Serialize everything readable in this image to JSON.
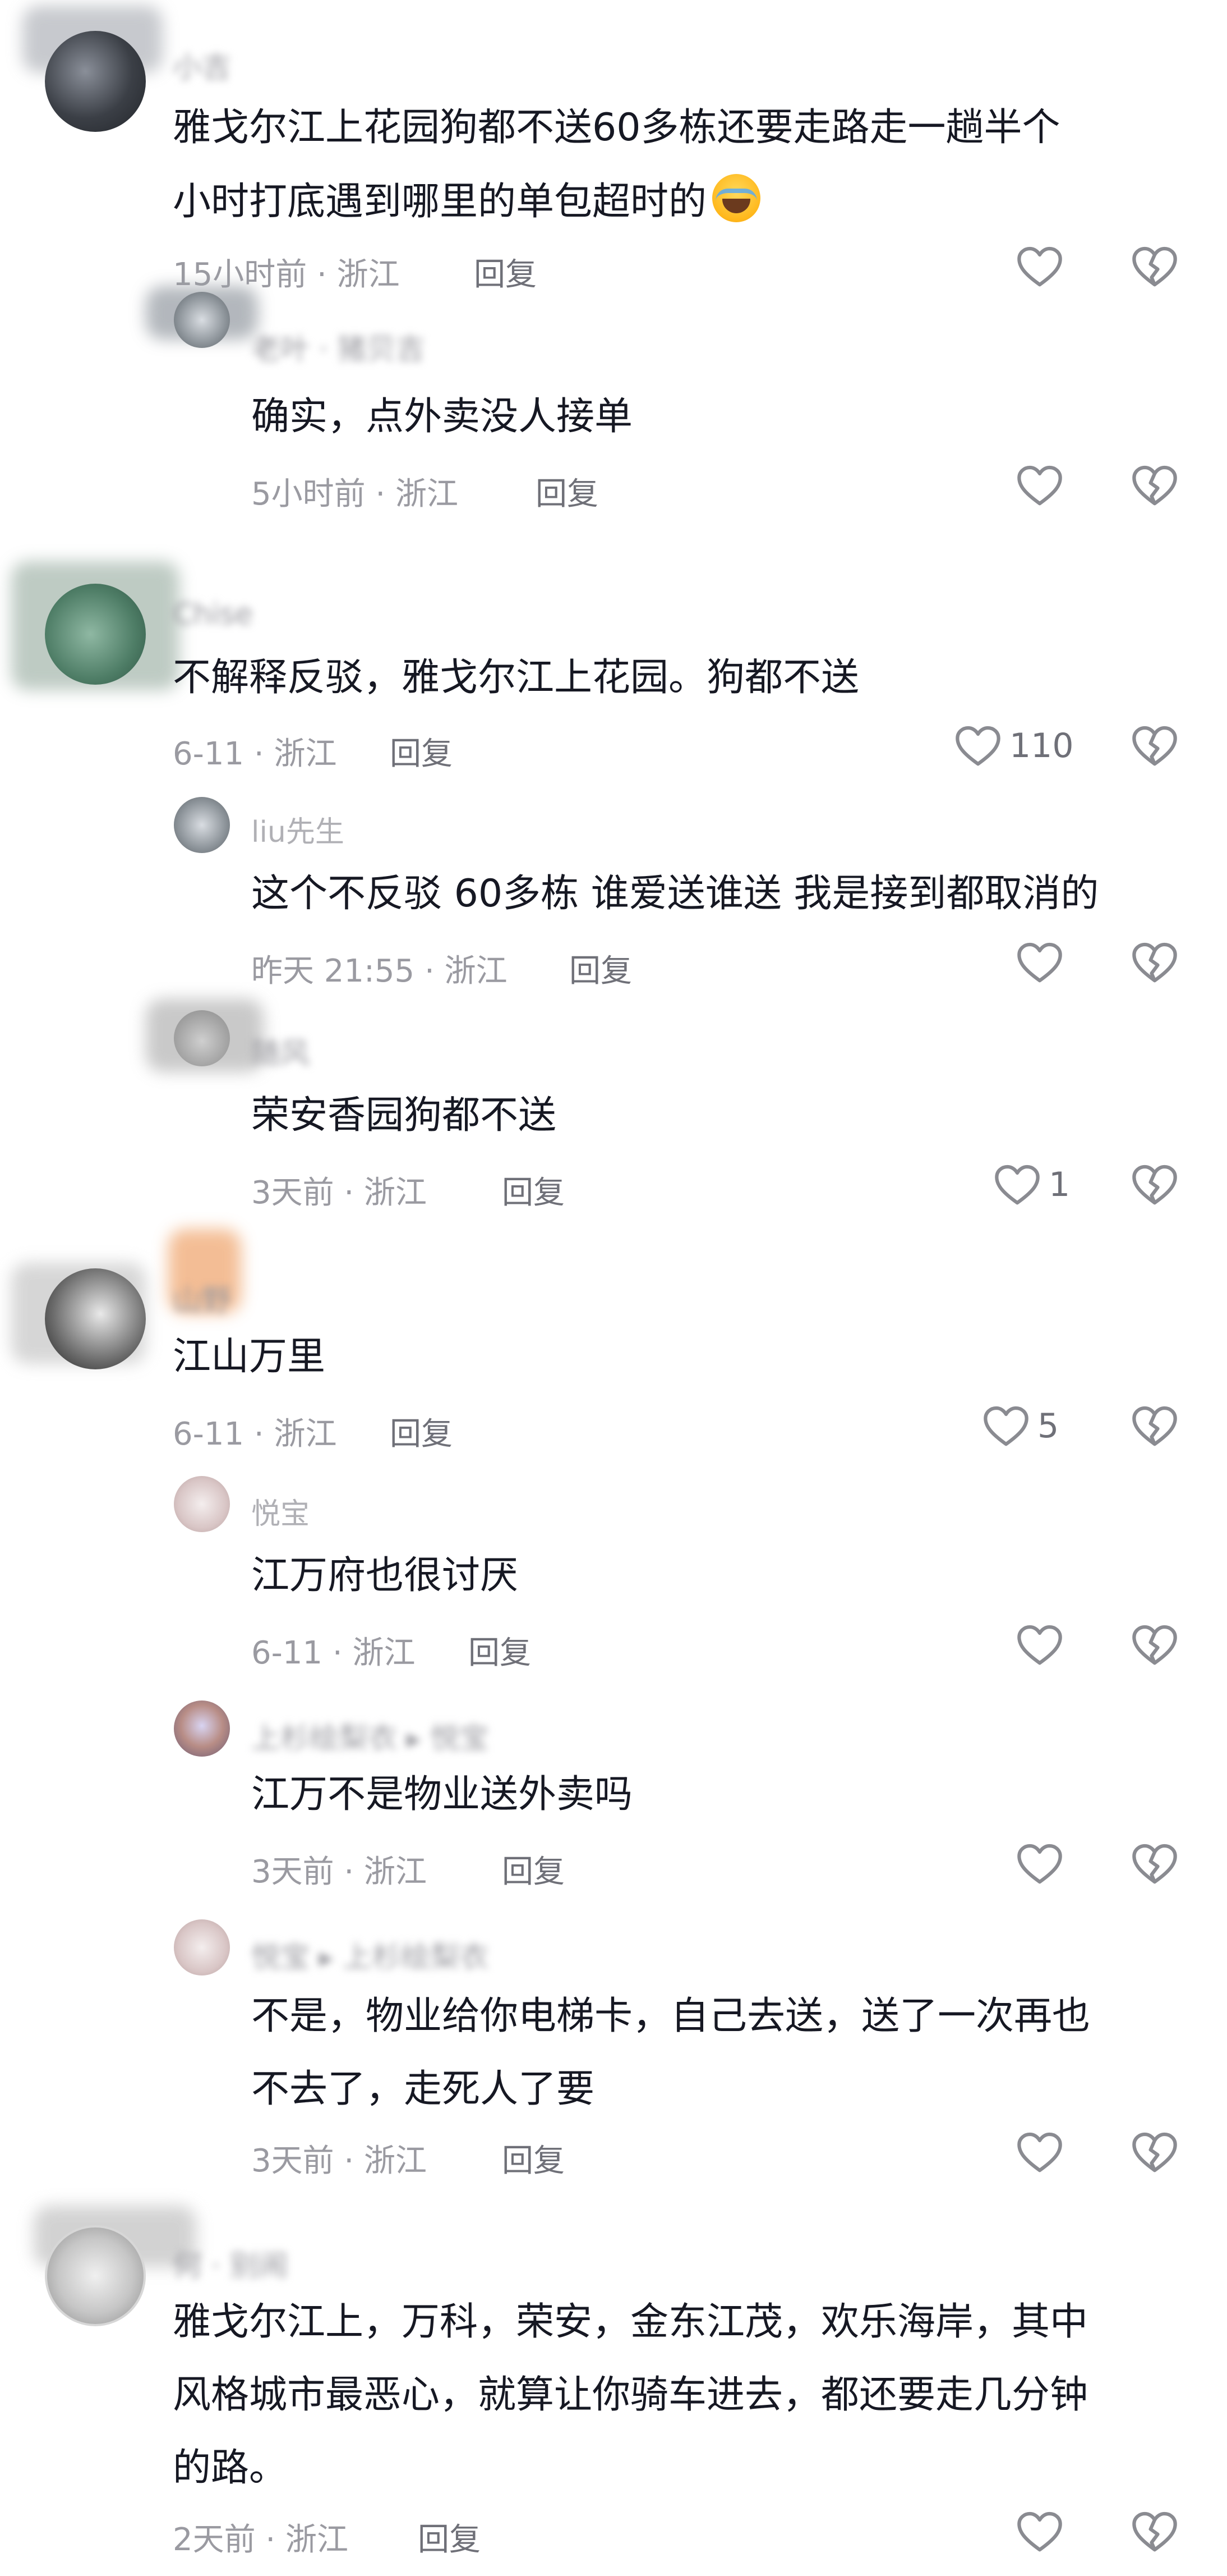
{
  "reply_label": "回复",
  "comments": [
    {
      "name": "小吉",
      "text_lines": [
        "雅戈尔江上花园狗都不送60多栋还要走路走一趟半个",
        "小时打底遇到哪里的单包超时的"
      ],
      "meta": "15小时前 · 浙江",
      "likes": ""
    },
    {
      "name": "老叶 · 猪贝吉",
      "text_lines": [
        "确实，点外卖没人接单"
      ],
      "meta": "5小时前 · 浙江",
      "likes": ""
    },
    {
      "name": "Chise",
      "text_lines": [
        "不解释反驳，雅戈尔江上花园。狗都不送"
      ],
      "meta": "6-11 · 浙江",
      "likes": "110"
    },
    {
      "name": "liu先生",
      "text_lines": [
        "这个不反驳 60多栋 谁爱送谁送 我是接到都取消的"
      ],
      "meta": "昨天 21:55 · 浙江",
      "likes": ""
    },
    {
      "name": "随风",
      "text_lines": [
        "荣安香园狗都不送"
      ],
      "meta": "3天前 · 浙江",
      "likes": "1"
    },
    {
      "name": "山野",
      "text_lines": [
        "江山万里"
      ],
      "meta": "6-11 · 浙江",
      "likes": "5"
    },
    {
      "name": "悦宝",
      "text_lines": [
        "江万府也很讨厌"
      ],
      "meta": "6-11 · 浙江",
      "likes": ""
    },
    {
      "name": "上杉绘梨衣 ▸ 悦宝",
      "text_lines": [
        "江万不是物业送外卖吗"
      ],
      "meta": "3天前 · 浙江",
      "likes": ""
    },
    {
      "name": "悦宝 ▸ 上杉绘梨衣",
      "text_lines": [
        "不是，物业给你电梯卡，自己去送，送了一次再也",
        "不去了，走死人了要"
      ],
      "meta": "3天前 · 浙江",
      "likes": ""
    },
    {
      "name": "何 · 别闹",
      "text_lines": [
        "雅戈尔江上，万科，荣安，金东江茂，欢乐海岸，其中",
        "风格城市最恶心，就算让你骑车进去，都还要走几分钟",
        "的路。"
      ],
      "meta": "2天前 · 浙江",
      "likes": ""
    }
  ]
}
